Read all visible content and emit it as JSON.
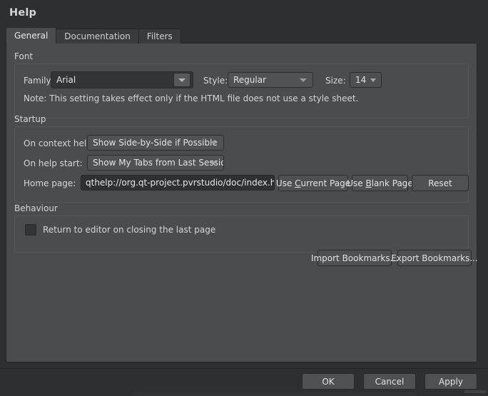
{
  "window": {
    "title": "Help"
  },
  "tabs": [
    {
      "label": "General",
      "active": true
    },
    {
      "label": "Documentation",
      "active": false
    },
    {
      "label": "Filters",
      "active": false
    }
  ],
  "font_group": {
    "title": "Font",
    "family_label": "Family:",
    "family_value": "Arial",
    "style_label": "Style:",
    "style_value": "Regular",
    "size_label": "Size:",
    "size_value": "14",
    "note": "Note: This setting takes effect only if the HTML file does not use a style sheet."
  },
  "startup_group": {
    "title": "Startup",
    "context_help_label": "On context help:",
    "context_help_value": "Show Side-by-Side if Possible",
    "help_start_label": "On help start:",
    "help_start_value": "Show My Tabs from Last Session",
    "home_page_label": "Home page:",
    "home_page_value": "qthelp://org.qt-project.pvrstudio/doc/index.html",
    "use_current_page_button": "Use Current Page",
    "use_current_page_mnemonic": "C",
    "use_blank_page_button": "Use Blank Page",
    "use_blank_page_mnemonic": "B",
    "reset_button": "Reset"
  },
  "behaviour_group": {
    "title": "Behaviour",
    "return_to_editor_label": "Return to editor on closing the last page",
    "return_to_editor_checked": false
  },
  "bookmarks": {
    "import_button": "Import Bookmarks...",
    "export_button": "Export Bookmarks..."
  },
  "dialog_buttons": {
    "ok": "OK",
    "cancel": "Cancel",
    "apply": "Apply"
  },
  "colors": {
    "window_bg": "#2e2f30",
    "panel_bg": "#4b4c4d",
    "input_bg": "#2f3031",
    "button_bg": "#4f5052",
    "text": "#d8d8d8",
    "border": "#262626"
  }
}
